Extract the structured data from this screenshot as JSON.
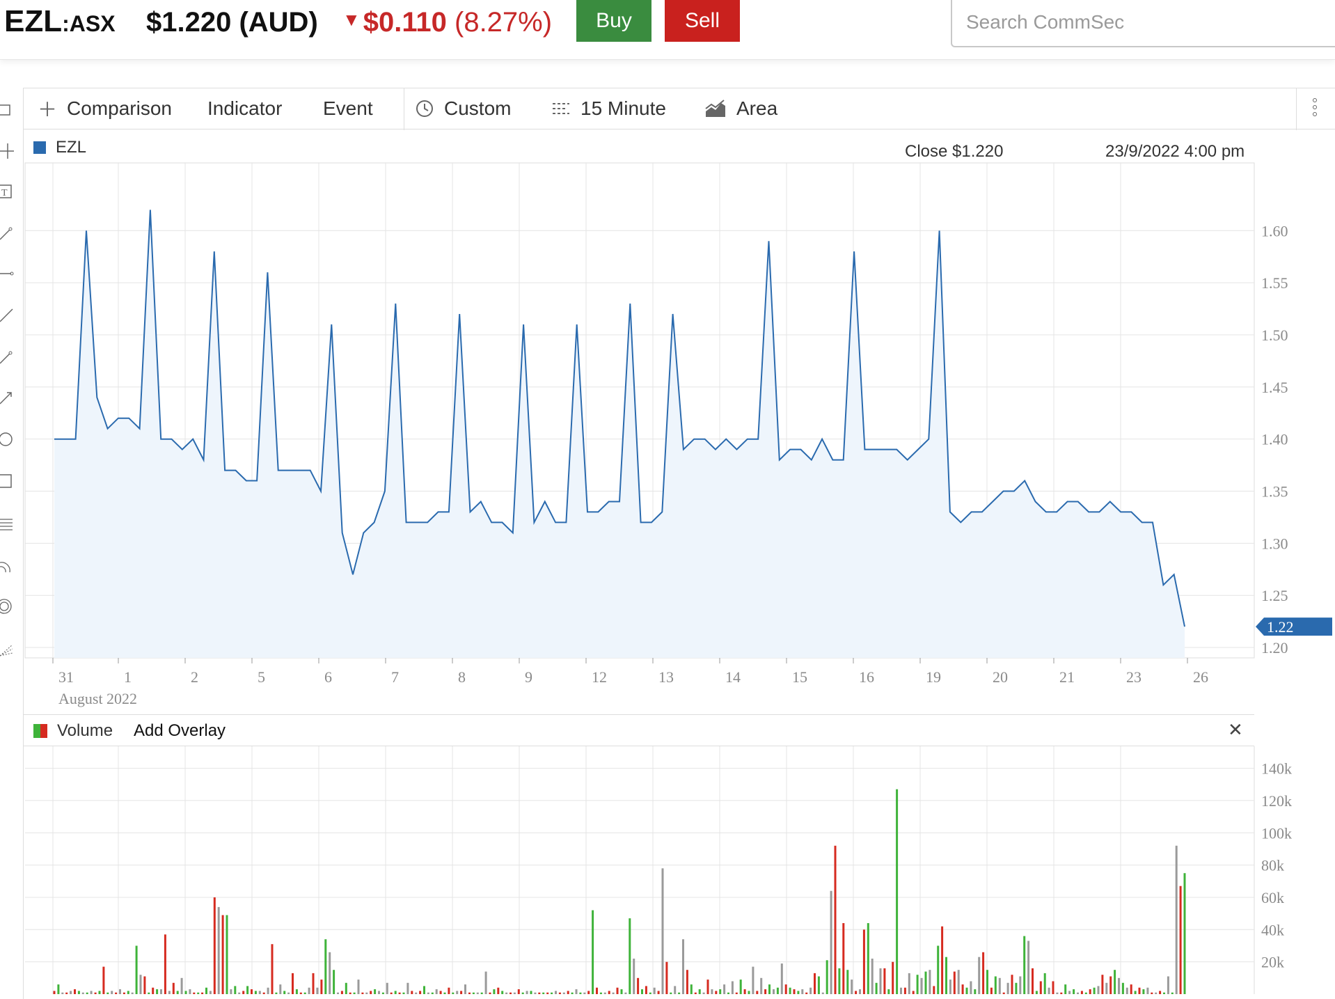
{
  "header": {
    "ticker": "EZL",
    "exchange": ":ASX",
    "price": "$1.220 (AUD)",
    "change_amount": "$0.110",
    "change_percent": "(8.27%)",
    "buy_label": "Buy",
    "sell_label": "Sell",
    "search_placeholder": "Search CommSec"
  },
  "toolbar": {
    "comparison": "Comparison",
    "indicator": "Indicator",
    "event": "Event",
    "range": "Custom",
    "interval": "15 Minute",
    "chart_type": "Area"
  },
  "legend": {
    "symbol": "EZL",
    "close": "Close $1.220",
    "datetime": "23/9/2022 4:00 pm"
  },
  "volume_panel": {
    "label": "Volume",
    "add_overlay": "Add Overlay"
  },
  "colors": {
    "line": "#2a6aae",
    "area": "#eef5fc",
    "up": "#3fb33a",
    "down": "#d62b20",
    "neutral": "#9a9a9a",
    "buy": "#3a8c3f",
    "sell": "#c9211e",
    "change": "#c62828"
  },
  "chart_data": [
    {
      "type": "area",
      "series": [
        {
          "name": "EZL",
          "values": [
            1.4,
            1.4,
            1.4,
            1.6,
            1.44,
            1.41,
            1.42,
            1.42,
            1.41,
            1.62,
            1.4,
            1.4,
            1.39,
            1.4,
            1.38,
            1.58,
            1.37,
            1.37,
            1.36,
            1.36,
            1.56,
            1.37,
            1.37,
            1.37,
            1.37,
            1.35,
            1.51,
            1.31,
            1.27,
            1.31,
            1.32,
            1.35,
            1.53,
            1.32,
            1.32,
            1.32,
            1.33,
            1.33,
            1.52,
            1.33,
            1.34,
            1.32,
            1.32,
            1.31,
            1.51,
            1.32,
            1.34,
            1.32,
            1.32,
            1.51,
            1.33,
            1.33,
            1.34,
            1.34,
            1.53,
            1.32,
            1.32,
            1.33,
            1.52,
            1.39,
            1.4,
            1.4,
            1.39,
            1.4,
            1.39,
            1.4,
            1.4,
            1.59,
            1.38,
            1.39,
            1.39,
            1.38,
            1.4,
            1.38,
            1.38,
            1.58,
            1.39,
            1.39,
            1.39,
            1.39,
            1.38,
            1.39,
            1.4,
            1.6,
            1.33,
            1.32,
            1.33,
            1.33,
            1.34,
            1.35,
            1.35,
            1.36,
            1.34,
            1.33,
            1.33,
            1.34,
            1.34,
            1.33,
            1.33,
            1.34,
            1.33,
            1.33,
            1.32,
            1.32,
            1.26,
            1.27,
            1.22
          ]
        }
      ],
      "x_tick_labels": [
        "31",
        "1",
        "2",
        "5",
        "6",
        "7",
        "8",
        "9",
        "12",
        "13",
        "14",
        "15",
        "16",
        "19",
        "20",
        "21",
        "23",
        "26"
      ],
      "x_sublabel": "August 2022",
      "y_tick_labels": [
        "1.60",
        "1.55",
        "1.50",
        "1.45",
        "1.40",
        "1.35",
        "1.30",
        "1.25",
        "1.20"
      ],
      "ylim": [
        1.19,
        1.665
      ],
      "last_value_label": "1.22",
      "grid": true
    },
    {
      "type": "bar",
      "series": [
        {
          "name": "Volume",
          "values": [
            2,
            6,
            1,
            1,
            2,
            3,
            2,
            1,
            1,
            2,
            1,
            2,
            17,
            1,
            2,
            1,
            3,
            1,
            2,
            1,
            30,
            12,
            11,
            1,
            4,
            3,
            3,
            37,
            2,
            7,
            2,
            10,
            2,
            3,
            1,
            1,
            1,
            4,
            2,
            60,
            54,
            49,
            49,
            3,
            5,
            1,
            2,
            5,
            3,
            2,
            2,
            1,
            4,
            31,
            1,
            6,
            2,
            1,
            13,
            3,
            1,
            1,
            4,
            13,
            4,
            9,
            34,
            26,
            15,
            1,
            2,
            7,
            1,
            1,
            9,
            1,
            1,
            2,
            3,
            2,
            1,
            7,
            1,
            2,
            1,
            1,
            7,
            2,
            1,
            2,
            5,
            1,
            1,
            3,
            2,
            1,
            4,
            1,
            2,
            2,
            6,
            1,
            1,
            1,
            1,
            14,
            1,
            3,
            4,
            2,
            1,
            1,
            1,
            3,
            1,
            2,
            2,
            1,
            1,
            1,
            1,
            1,
            2,
            1,
            1,
            2,
            1,
            3,
            1,
            1,
            2,
            52,
            4,
            1,
            1,
            2,
            1,
            4,
            3,
            1,
            47,
            22,
            10,
            3,
            5,
            1,
            4,
            2,
            78,
            20,
            1,
            5,
            1,
            34,
            15,
            6,
            1,
            3,
            1,
            9,
            3,
            2,
            3,
            6,
            1,
            8,
            1,
            9,
            3,
            2,
            17,
            2,
            10,
            3,
            6,
            3,
            4,
            19,
            6,
            4,
            3,
            2,
            3,
            1,
            4,
            13,
            11,
            1,
            21,
            64,
            92,
            16,
            44,
            15,
            9,
            2,
            3,
            40,
            44,
            22,
            7,
            16,
            16,
            3,
            20,
            127,
            4,
            4,
            13,
            2,
            12,
            10,
            14,
            15,
            5,
            30,
            42,
            23,
            9,
            14,
            15,
            6,
            4,
            8,
            3,
            23,
            26,
            15,
            4,
            11,
            10,
            1,
            7,
            12,
            7,
            11,
            36,
            33,
            16,
            2,
            8,
            13,
            4,
            8,
            1,
            1,
            6,
            2,
            3,
            1,
            2,
            1,
            3,
            4,
            5,
            12,
            7,
            11,
            15,
            10,
            7,
            4,
            6,
            2,
            4,
            3,
            4,
            1,
            1,
            2,
            1,
            11,
            1,
            92,
            67,
            75
          ]
        }
      ],
      "y_tick_labels": [
        "140k",
        "120k",
        "100k",
        "80k",
        "60k",
        "40k",
        "20k"
      ],
      "ylim": [
        0,
        145
      ]
    }
  ]
}
